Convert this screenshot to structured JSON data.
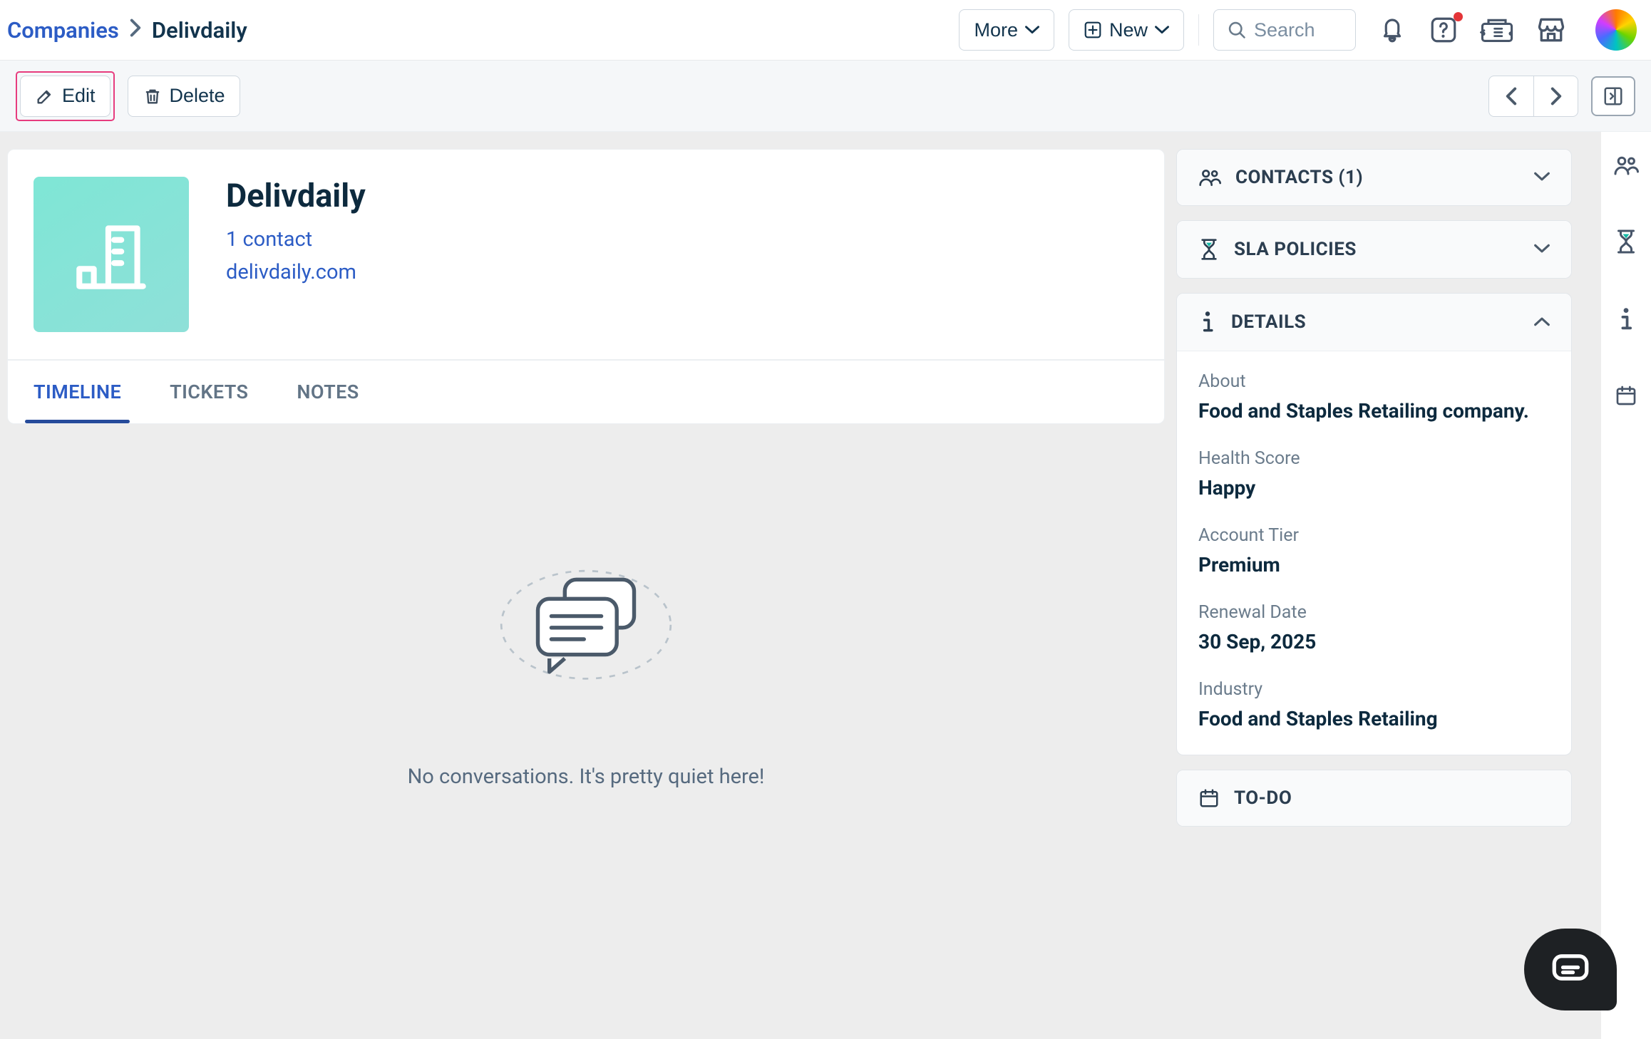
{
  "breadcrumb": {
    "root": "Companies",
    "current": "Delivdaily"
  },
  "header": {
    "more_label": "More",
    "new_label": "New",
    "search_placeholder": "Search"
  },
  "toolbar": {
    "edit_label": "Edit",
    "delete_label": "Delete"
  },
  "company": {
    "name": "Delivdaily",
    "contact_count_label": "1 contact",
    "domain": "delivdaily.com"
  },
  "tabs": {
    "timeline": "TIMELINE",
    "tickets": "TICKETS",
    "notes": "NOTES"
  },
  "empty_state": "No conversations. It's pretty quiet here!",
  "side": {
    "contacts_title": "CONTACTS (1)",
    "sla_title": "SLA POLICIES",
    "details_title": "DETAILS",
    "todo_title": "TO-DO",
    "details": {
      "about_label": "About",
      "about_value": "Food and Staples Retailing company.",
      "health_label": "Health Score",
      "health_value": "Happy",
      "tier_label": "Account Tier",
      "tier_value": "Premium",
      "renewal_label": "Renewal Date",
      "renewal_value": "30 Sep, 2025",
      "industry_label": "Industry",
      "industry_value": "Food and Staples Retailing"
    }
  }
}
